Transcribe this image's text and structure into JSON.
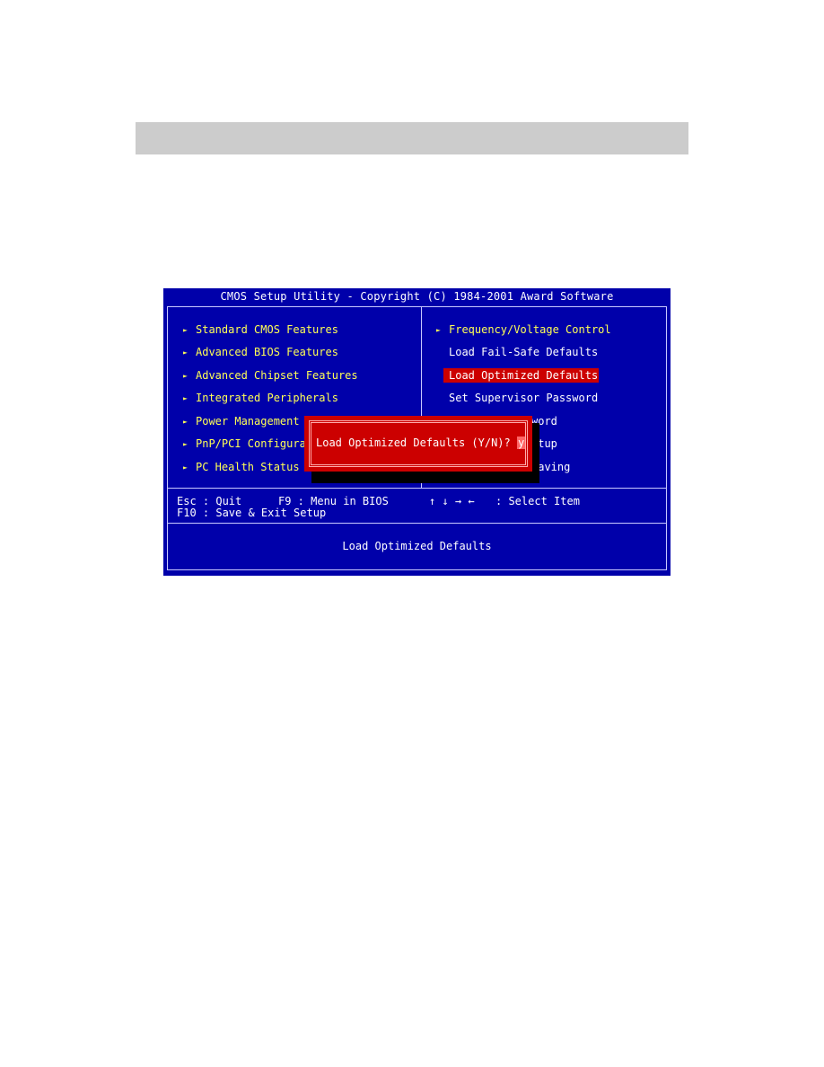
{
  "page": {
    "header_bar_text": ""
  },
  "bios": {
    "title": "CMOS Setup Utility - Copyright (C) 1984-2001 Award Software",
    "colors": {
      "background": "#0000aa",
      "menu_submenu": "#ffff55",
      "menu_action": "#ffffff",
      "highlight": "#cc0000",
      "dialog": "#cc0000"
    },
    "left_menu": [
      {
        "label": "Standard CMOS Features",
        "submenu": true
      },
      {
        "label": "Advanced BIOS Features",
        "submenu": true
      },
      {
        "label": "Advanced Chipset Features",
        "submenu": true
      },
      {
        "label": "Integrated Peripherals",
        "submenu": true
      },
      {
        "label": "Power Management",
        "submenu": true
      },
      {
        "label": "PnP/PCI Configura",
        "submenu": true
      },
      {
        "label": "PC Health Status",
        "submenu": true
      }
    ],
    "right_menu": [
      {
        "label": "Frequency/Voltage Control",
        "submenu": true
      },
      {
        "label": "Load Fail-Safe Defaults",
        "submenu": false
      },
      {
        "label": "Load Optimized Defaults",
        "submenu": false,
        "selected": true
      },
      {
        "label": "Set Supervisor Password",
        "submenu": false
      },
      {
        "label": "word",
        "submenu": false,
        "partially_obscured": true
      },
      {
        "label": "etup",
        "submenu": false,
        "partially_obscured": true
      },
      {
        "label": "Saving",
        "submenu": false,
        "partially_obscured": true
      }
    ],
    "arrow_icon": "►",
    "help": {
      "line1_col1": "Esc : Quit",
      "line1_col2": "F9 : Menu in BIOS",
      "line1_col3_arrows": "↑ ↓ → ←",
      "line1_col3_label": ": Select Item",
      "line2": "F10 : Save & Exit Setup"
    },
    "status_text": "Load Optimized Defaults",
    "dialog": {
      "prompt": "Load Optimized Defaults (Y/N)?",
      "answer": "y"
    }
  }
}
